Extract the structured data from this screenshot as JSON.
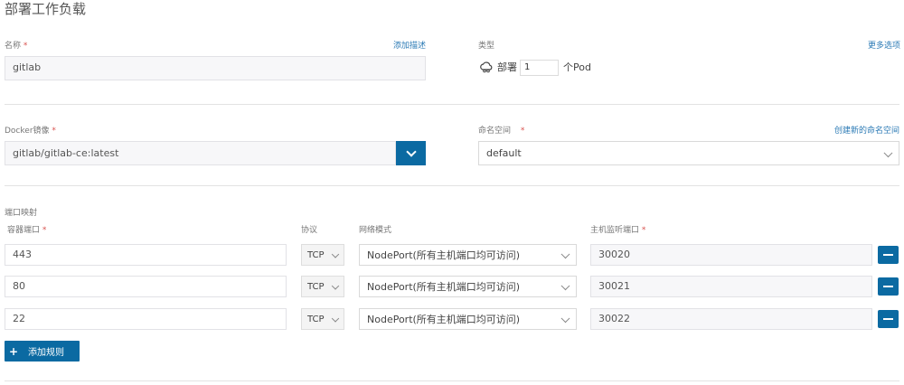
{
  "page": {
    "title": "部署工作负载"
  },
  "name_field": {
    "label": "名称",
    "required_mark": "*",
    "value": "gitlab",
    "add_desc_link": "添加描述"
  },
  "type_field": {
    "label": "类型",
    "more_options_link": "更多选项",
    "deploy_label": "部署",
    "pod_count": "1",
    "pod_unit": "个Pod"
  },
  "image_field": {
    "label": "Docker镜像",
    "required_mark": "*",
    "value": "gitlab/gitlab-ce:latest"
  },
  "namespace_field": {
    "label": "命名空间",
    "required_mark": "*",
    "create_link": "创建新的命名空间",
    "value": "default"
  },
  "ports": {
    "section_title": "端口映射",
    "col_container": "容器端口",
    "col_protocol": "协议",
    "col_network": "网络模式",
    "col_host": "主机监听端口",
    "required_mark": "*",
    "rows": [
      {
        "container_port": "443",
        "protocol": "TCP",
        "network_mode": "NodePort(所有主机端口均可访问)",
        "host_port": "30020"
      },
      {
        "container_port": "80",
        "protocol": "TCP",
        "network_mode": "NodePort(所有主机端口均可访问)",
        "host_port": "30021"
      },
      {
        "container_port": "22",
        "protocol": "TCP",
        "network_mode": "NodePort(所有主机端口均可访问)",
        "host_port": "30022"
      }
    ],
    "add_rule_label": "添加规则"
  },
  "icons": {
    "deploy": "cloud-cluster-icon",
    "add": "plus-icon",
    "remove": "minus-icon",
    "dropdown": "chevron-down-icon"
  },
  "colors": {
    "primary": "#0b6aa2",
    "link": "#2b7ab5",
    "required": "#d9534f"
  }
}
